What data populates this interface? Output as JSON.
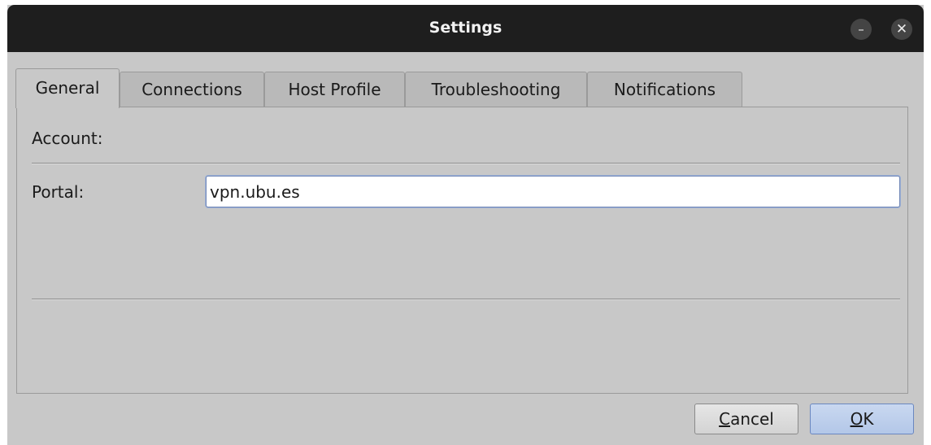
{
  "window": {
    "title": "Settings",
    "minimize_glyph": "–",
    "close_glyph": "✕"
  },
  "tabs": [
    {
      "label": "General",
      "active": true
    },
    {
      "label": "Connections",
      "active": false
    },
    {
      "label": "Host Profile",
      "active": false
    },
    {
      "label": "Troubleshooting",
      "active": false
    },
    {
      "label": "Notifications",
      "active": false
    }
  ],
  "general": {
    "account_label": "Account:",
    "portal_label": "Portal:",
    "portal_value": "vpn.ubu.es"
  },
  "buttons": {
    "cancel_prefix": "",
    "cancel_mnemonic": "C",
    "cancel_rest": "ancel",
    "ok_mnemonic": "O",
    "ok_rest": "K"
  },
  "colors": {
    "titlebar": "#1e1e1e",
    "window_bg": "#c8c8c8",
    "input_focus_border": "#6f86b5",
    "ok_button": "#b3c7e8"
  }
}
